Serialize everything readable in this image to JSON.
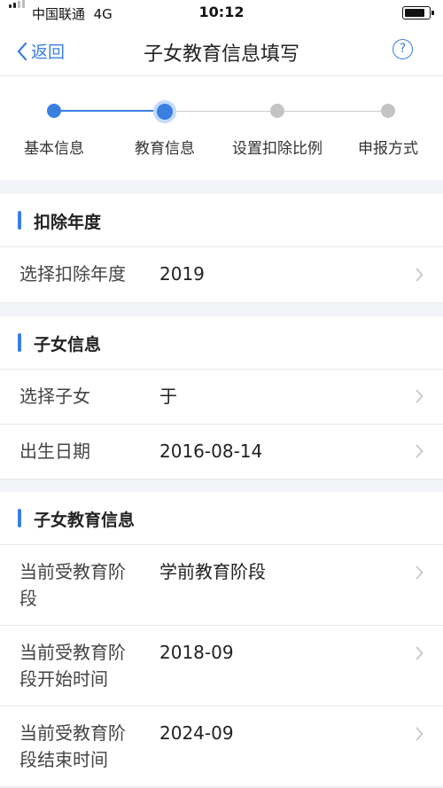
{
  "status_bar": {
    "carrier": "中国联通",
    "network": "4G",
    "time": "10:12"
  },
  "nav": {
    "back_label": "返回",
    "title": "子女教育信息填写",
    "help_symbol": "?"
  },
  "steps": [
    {
      "label": "基本信息",
      "state": "done"
    },
    {
      "label": "教育信息",
      "state": "current"
    },
    {
      "label": "设置扣除比例",
      "state": "pending"
    },
    {
      "label": "申报方式",
      "state": "pending"
    }
  ],
  "colors": {
    "accent": "#3a7fe0",
    "background": "#f2f4f8",
    "inactive": "#c4c4c4"
  },
  "sections": [
    {
      "title": "扣除年度",
      "rows": [
        {
          "label": "选择扣除年度",
          "value": "2019"
        }
      ]
    },
    {
      "title": "子女信息",
      "rows": [
        {
          "label": "选择子女",
          "value": "于"
        },
        {
          "label": "出生日期",
          "value": "2016-08-14"
        }
      ]
    },
    {
      "title": "子女教育信息",
      "rows": [
        {
          "label": "当前受教育阶段",
          "value": "学前教育阶段"
        },
        {
          "label": "当前受教育阶段开始时间",
          "value": "2018-09"
        },
        {
          "label": "当前受教育阶段结束时间",
          "value": "2024-09"
        }
      ]
    }
  ]
}
